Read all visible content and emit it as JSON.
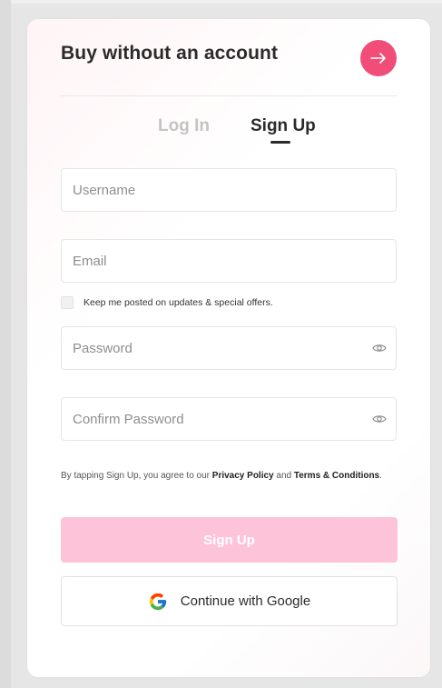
{
  "header": {
    "title": "Buy without an account",
    "go_icon": "arrow-right-icon",
    "accent_color": "#f04e78"
  },
  "tabs": [
    {
      "label": "Log In",
      "active": false
    },
    {
      "label": "Sign Up",
      "active": true
    }
  ],
  "form": {
    "username": {
      "placeholder": "Username",
      "value": ""
    },
    "email": {
      "placeholder": "Email",
      "value": ""
    },
    "newsletter": {
      "label": "Keep me posted on updates & special offers.",
      "checked": false
    },
    "password": {
      "placeholder": "Password",
      "value": "",
      "icon": "eye-icon"
    },
    "confirm_password": {
      "placeholder": "Confirm Password",
      "value": "",
      "icon": "eye-icon"
    }
  },
  "terms": {
    "prefix": "By tapping Sign Up, you agree to our ",
    "privacy_link": "Privacy Policy",
    "and": " and ",
    "terms_link": "Terms & Conditions",
    "suffix": "."
  },
  "actions": {
    "signup_label": "Sign Up",
    "signup_color": "#fdc3d9",
    "google_label": "Continue with Google",
    "google_icon": "google-icon"
  }
}
